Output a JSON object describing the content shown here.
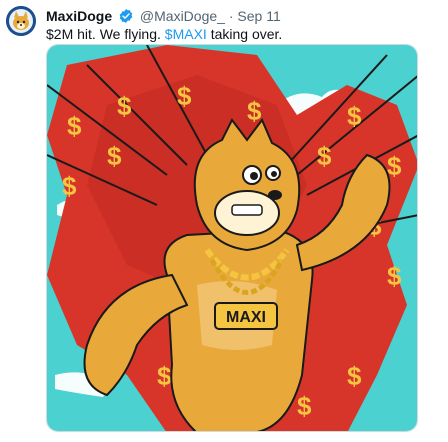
{
  "author": {
    "display_name": "MaxiDoge",
    "handle": "@MaxiDoge_",
    "separator": "·",
    "date": "Sep 11",
    "verified_icon": "verified-badge-icon"
  },
  "post": {
    "text_before": "$2M hit. We flying. ",
    "cashtag": "$MAXI",
    "text_after": " taking over."
  },
  "media": {
    "alt_label": "Muscular doge with gold chain",
    "chain_text": "MAXI",
    "bg_color": "#4bd1cf",
    "splash_color": "#d8352a",
    "dollar_color": "#f5c542",
    "dog_color": "#e8a93a"
  },
  "colors": {
    "link": "#1d9bf0",
    "verified": "#1d9bf0",
    "muted": "#536471"
  }
}
